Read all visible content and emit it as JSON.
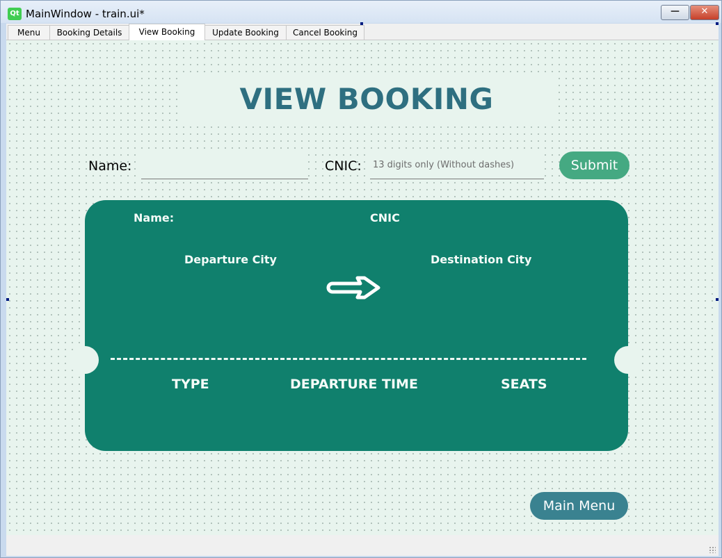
{
  "window": {
    "title": "MainWindow - train.ui*",
    "logo_text": "Qt",
    "minimize_glyph": "—",
    "close_glyph": "✕"
  },
  "tabs": [
    {
      "label": "Menu"
    },
    {
      "label": "Booking Details"
    },
    {
      "label": "View Booking",
      "active": true
    },
    {
      "label": "Update Booking"
    },
    {
      "label": "Cancel Booking"
    }
  ],
  "page": {
    "heading": "VIEW BOOKING"
  },
  "form": {
    "name_label": "Name:",
    "name_value": "",
    "cnic_label": "CNIC:",
    "cnic_placeholder": "13 digits only (Without dashes)",
    "submit_label": "Submit"
  },
  "ticket": {
    "name_label": "Name:",
    "cnic_label": "CNIC",
    "departure_city_label": "Departure City",
    "destination_city_label": "Destination City",
    "arrow_icon": "train-arrow-icon",
    "type_label": "TYPE",
    "departure_time_label": "DEPARTURE TIME",
    "seats_label": "SEATS"
  },
  "footer": {
    "main_menu_label": "Main Menu"
  },
  "colors": {
    "heading": "#2e6f80",
    "ticket": "#10806d",
    "submit": "#45a982",
    "main_menu": "#3a8290",
    "content_bg": "#e8f4ee"
  }
}
